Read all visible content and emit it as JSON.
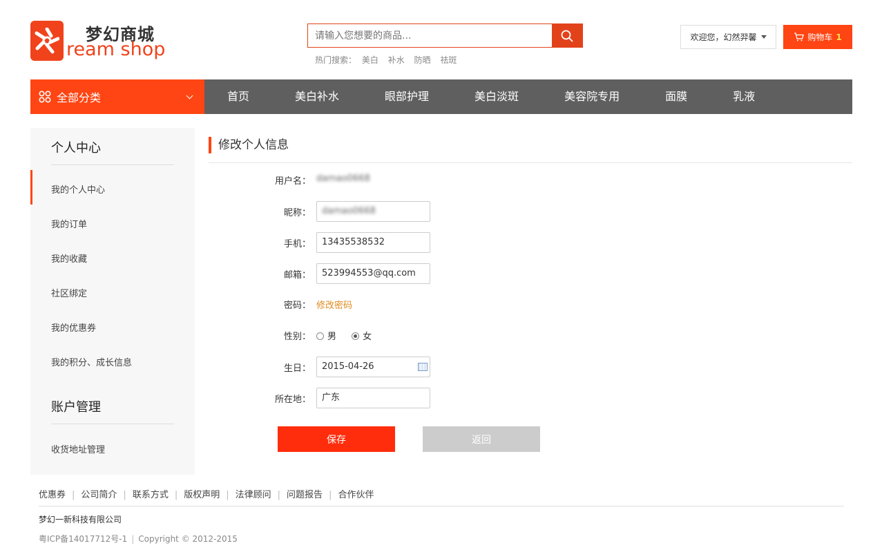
{
  "brand": {
    "name_cn": "梦幻商城",
    "name_en": "ream shop",
    "color": "#f0431c"
  },
  "search": {
    "placeholder": "请输入您想要的商品...",
    "hot_label": "热门搜索：",
    "hot_terms": [
      "美白",
      "补水",
      "防晒",
      "祛斑"
    ]
  },
  "user": {
    "welcome": "欢迎您，幻然羿馨"
  },
  "cart": {
    "label": "购物车",
    "count": "1"
  },
  "nav": {
    "category_label": "全部分类",
    "items": [
      "首页",
      "美白补水",
      "眼部护理",
      "美白淡斑",
      "美容院专用",
      "面膜",
      "乳液"
    ]
  },
  "sidebar": {
    "section1_title": "个人中心",
    "section1_items": [
      "我的个人中心",
      "我的订单",
      "我的收藏",
      "社区绑定",
      "我的优惠券",
      "我的积分、成长信息"
    ],
    "section2_title": "账户管理",
    "section2_items": [
      "收货地址管理"
    ]
  },
  "main": {
    "title": "修改个人信息",
    "form": {
      "username_label": "用户名：",
      "username_value": "damao0668",
      "nickname_label": "昵称：",
      "nickname_value": "damao0668",
      "phone_label": "手机：",
      "phone_value": "13435538532",
      "email_label": "邮箱：",
      "email_value": "523994553@qq.com",
      "password_label": "密码：",
      "password_link": "修改密码",
      "gender_label": "性别：",
      "gender_male": "男",
      "gender_female": "女",
      "gender_selected": "女",
      "birthday_label": "生日：",
      "birthday_value": "2015-04-26",
      "location_label": "所在地：",
      "location_value": "广东"
    },
    "save_label": "保存",
    "back_label": "返回"
  },
  "footer": {
    "links": [
      "优惠券",
      "公司简介",
      "联系方式",
      "版权声明",
      "法律顾问",
      "问题报告",
      "合作伙伴"
    ],
    "company": "梦幻一新科技有限公司",
    "icp": "粤ICP备14017712号-1",
    "copyright": "Copyright © 2012-2015"
  }
}
